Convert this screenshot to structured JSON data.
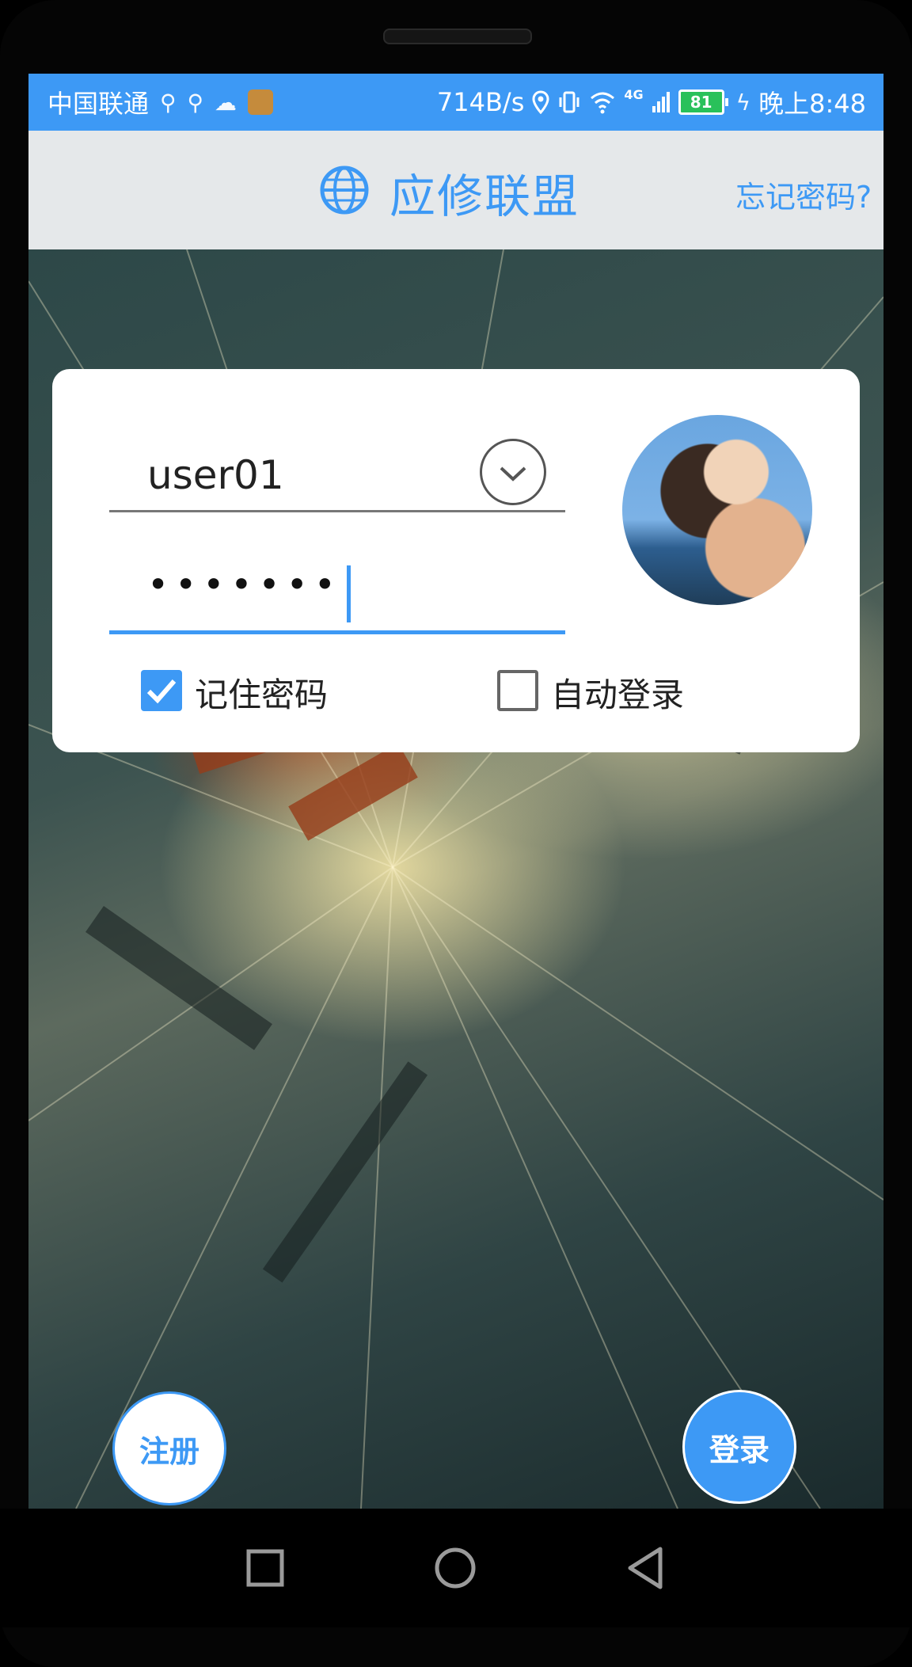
{
  "status_bar": {
    "carrier": "中国联通",
    "usb_icons": [
      "usb-icon",
      "usb-icon"
    ],
    "weather_icon": "cloud-icon",
    "app_icon": "app-notification-icon",
    "speed": "714B/s",
    "location_icon": "location-icon",
    "vibrate_icon": "vibrate-icon",
    "wifi_icon": "wifi-icon",
    "network_type": "4G",
    "signal_icon": "signal-icon",
    "battery_level": "81",
    "charging_icon": "charging-icon",
    "time": "晚上8:48"
  },
  "header": {
    "logo_icon": "globe-icon",
    "title": "应修联盟",
    "forgot_password": "忘记密码?"
  },
  "login_form": {
    "username": "user01",
    "dropdown_icon": "chevron-down-icon",
    "password_masked": "•••••••",
    "avatar": "user-avatar",
    "remember_password": {
      "label": "记住密码",
      "checked": true
    },
    "auto_login": {
      "label": "自动登录",
      "checked": false
    }
  },
  "actions": {
    "register": "注册",
    "login": "登录"
  },
  "nav_bar": [
    "recent-apps-icon",
    "home-icon",
    "back-icon"
  ],
  "colors": {
    "accent": "#3d99f5",
    "header_bg": "#e5e8ea",
    "card_bg": "#ffffff"
  }
}
